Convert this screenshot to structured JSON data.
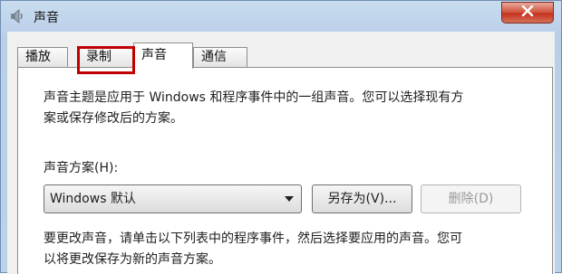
{
  "window": {
    "title": "声音",
    "icon": "speaker-icon",
    "close_icon": "close-icon"
  },
  "tabs": [
    {
      "label": "播放",
      "selected": false
    },
    {
      "label": "录制",
      "selected": false,
      "highlighted": true
    },
    {
      "label": "声音",
      "selected": true
    },
    {
      "label": "通信",
      "selected": false
    }
  ],
  "panel": {
    "description_line1": "声音主题是应用于 Windows 和程序事件中的一组声音。您可以选择现有方",
    "description_line2": "案或保存修改后的方案。",
    "scheme_label": "声音方案(H):",
    "scheme_value": "Windows 默认",
    "save_as_label": "另存为(V)...",
    "delete_label": "删除(D)",
    "instruction_line1": "要更改声音，请单击以下列表中的程序事件，然后选择要应用的声音。您可",
    "instruction_line2": "以将更改保存为新的声音方案。"
  },
  "colors": {
    "highlight_box": "#c00000",
    "close_button": "#c4301b"
  }
}
